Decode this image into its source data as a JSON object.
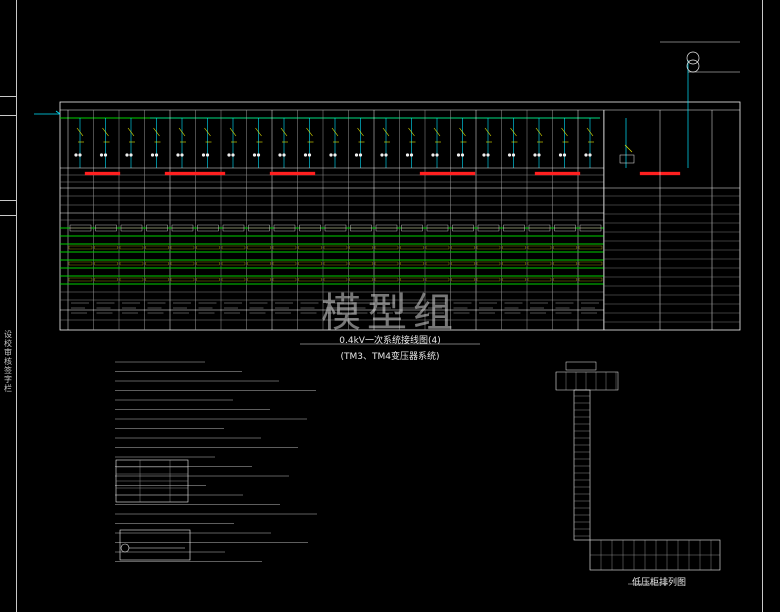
{
  "title_line1": "0.4kV一次系统接线图(4)",
  "title_line2": "(TM3、TM4变压器系统)",
  "watermark": "模型组",
  "lower_right_caption": "低压柜排列图",
  "left_margin_text": "设 校 审 核 签 字 栏",
  "colors": {
    "background": "#000000",
    "frame": "#c8c8c8",
    "cyan": "#00e5ff",
    "green": "#00d000",
    "yellow": "#e8e800",
    "red": "#ff2020",
    "magenta": "#ff3cc8",
    "white": "#f0f0f0"
  }
}
